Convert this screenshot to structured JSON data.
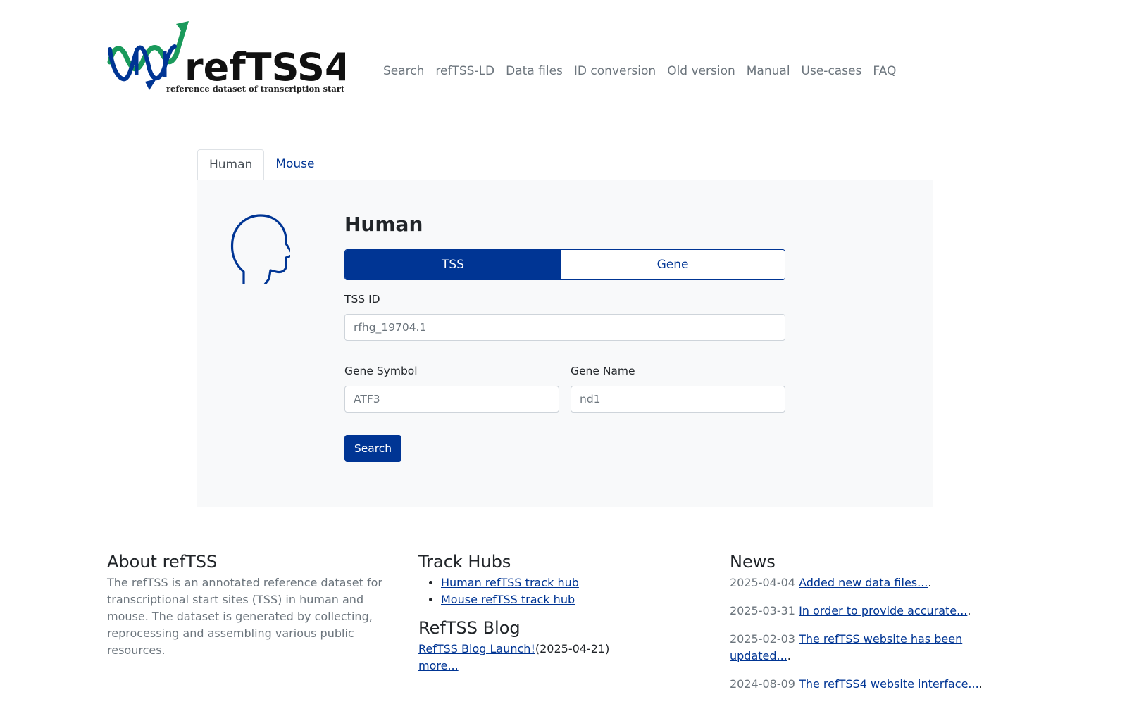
{
  "header": {
    "logo_word": "refTSS4",
    "logo_tagline": "reference dataset of transcription start sites",
    "nav": [
      "Search",
      "refTSS-LD",
      "Data files",
      "ID conversion",
      "Old version",
      "Manual",
      "Use-cases",
      "FAQ"
    ]
  },
  "tabs": [
    {
      "label": "Human",
      "active": true
    },
    {
      "label": "Mouse",
      "active": false
    }
  ],
  "panel": {
    "title": "Human",
    "toggle": {
      "tss": "TSS",
      "gene": "Gene"
    },
    "tss_id_label": "TSS ID",
    "tss_id_placeholder": "rfhg_19704.1",
    "gene_symbol_label": "Gene Symbol",
    "gene_symbol_placeholder": "ATF3",
    "gene_name_label": "Gene Name",
    "gene_name_placeholder": "nd1",
    "search_label": "Search"
  },
  "about": {
    "title": "About refTSS",
    "text": "The refTSS is an annotated reference dataset for transcriptional start sites (TSS) in human and mouse. The dataset is generated by collecting, reprocessing and assembling various public resources."
  },
  "trackhubs": {
    "title": "Track Hubs",
    "items": [
      "Human refTSS track hub",
      "Mouse refTSS track hub"
    ]
  },
  "blog": {
    "title": "RefTSS Blog",
    "entry_link": "RefTSS Blog Launch!",
    "entry_date": "(2025-04-21)",
    "more": "more..."
  },
  "news": {
    "title": "News",
    "items": [
      {
        "date": "2025-04-04",
        "link": "Added new data files...",
        "tail": "."
      },
      {
        "date": "2025-03-31",
        "link": "In order to provide accurate...",
        "tail": "."
      },
      {
        "date": "2025-02-03",
        "link": "The refTSS website has been updated...",
        "tail": "."
      },
      {
        "date": "2024-08-09",
        "link": "The refTSS4 website interface...",
        "tail": "."
      }
    ]
  },
  "colors": {
    "brand_blue": "#003594",
    "brand_green": "#1a9a5b",
    "panel_bg": "#f8f9fa"
  },
  "icons": {
    "logo": "dna-helix-arrow-icon",
    "species": "human-head-icon"
  }
}
